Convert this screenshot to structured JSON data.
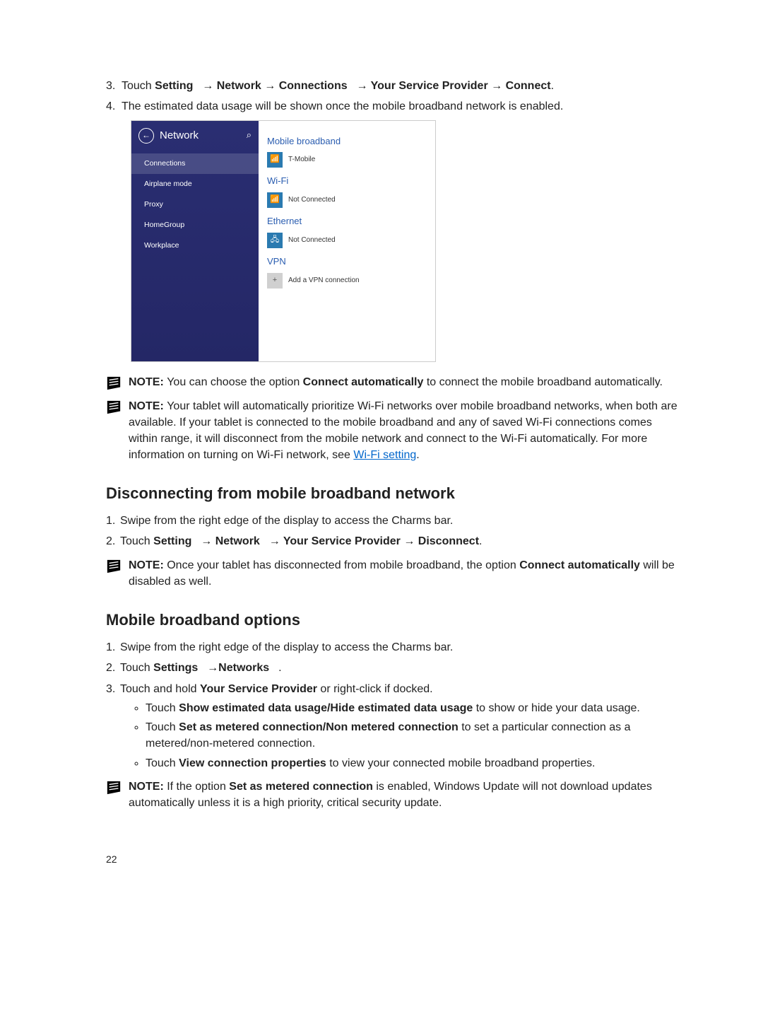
{
  "step3": {
    "prefix": "Touch ",
    "setting": "Setting ",
    "arrow1": " → ",
    "network": "Network",
    "arrow2": " → ",
    "connections": "Connections ",
    "arrow3": " → ",
    "provider": "Your Service Provider",
    "arrow4": " → ",
    "connect": "Connect",
    "period": "."
  },
  "step4": "The estimated data usage will be shown once the mobile broadband network is enabled.",
  "screenshot": {
    "header": "Network",
    "sidebar": [
      "Connections",
      "Airplane mode",
      "Proxy",
      "HomeGroup",
      "Workplace"
    ],
    "mb_title": "Mobile broadband",
    "mb_item": "T-Mobile",
    "wifi_title": "Wi-Fi",
    "wifi_item": "Not Connected",
    "eth_title": "Ethernet",
    "eth_item": "Not Connected",
    "vpn_title": "VPN",
    "vpn_item": "Add a VPN connection"
  },
  "note1": {
    "label": "NOTE: ",
    "t1": "You can choose the option ",
    "bold": "Connect automatically",
    "t2": " to connect the mobile broadband automatically."
  },
  "note2": {
    "label": "NOTE: ",
    "t1": "Your tablet will automatically prioritize Wi-Fi networks over mobile broadband networks, when both are available. If your tablet is connected to the mobile broadband and any of saved Wi-Fi connections comes within range, it will disconnect from the mobile network and connect to the Wi-Fi automatically. For more information on turning on Wi-Fi network, see ",
    "link": "Wi-Fi setting",
    "t2": "."
  },
  "h_disconnect": "Disconnecting from mobile broadband network",
  "disc_step1": "Swipe from the right edge of the display to access the Charms bar.",
  "disc_step2": {
    "prefix": "Touch ",
    "setting": "Setting ",
    "arrow1": " → ",
    "network": "Network ",
    "arrow2": " → ",
    "provider": "Your Service Provider",
    "arrow3": " → ",
    "disconnect": "Disconnect",
    "period": "."
  },
  "note3": {
    "label": "NOTE: ",
    "t1": "Once your tablet has disconnected from mobile broadband, the option ",
    "bold": "Connect automatically",
    "t2": " will be disabled as well."
  },
  "h_options": "Mobile broadband options",
  "opt_step1": "Swipe from the right edge of the display to access the Charms bar.",
  "opt_step2": {
    "prefix": "Touch ",
    "settings": "Settings ",
    "arrow": " →",
    "networks": "Networks ",
    "period": " ."
  },
  "opt_step3": {
    "t1": "Touch and hold ",
    "bold": "Your Service Provider",
    "t2": " or right-click if docked."
  },
  "bul": {
    "a": {
      "t1": "Touch ",
      "bold": "Show estimated data usage/Hide estimated data usage",
      "t2": " to show or hide your data usage."
    },
    "b": {
      "t1": "Touch ",
      "bold": "Set as metered connection/Non metered connection",
      "t2": " to set a particular connection as a metered/non-metered connection."
    },
    "c": {
      "t1": "Touch ",
      "bold": "View connection properties",
      "t2": " to view your connected mobile broadband properties."
    }
  },
  "note4": {
    "label": "NOTE: ",
    "t1": "If the option ",
    "bold": "Set as metered connection",
    "t2": " is enabled, Windows Update will not download updates automatically unless it is a high priority, critical security update."
  },
  "pagenum": "22"
}
